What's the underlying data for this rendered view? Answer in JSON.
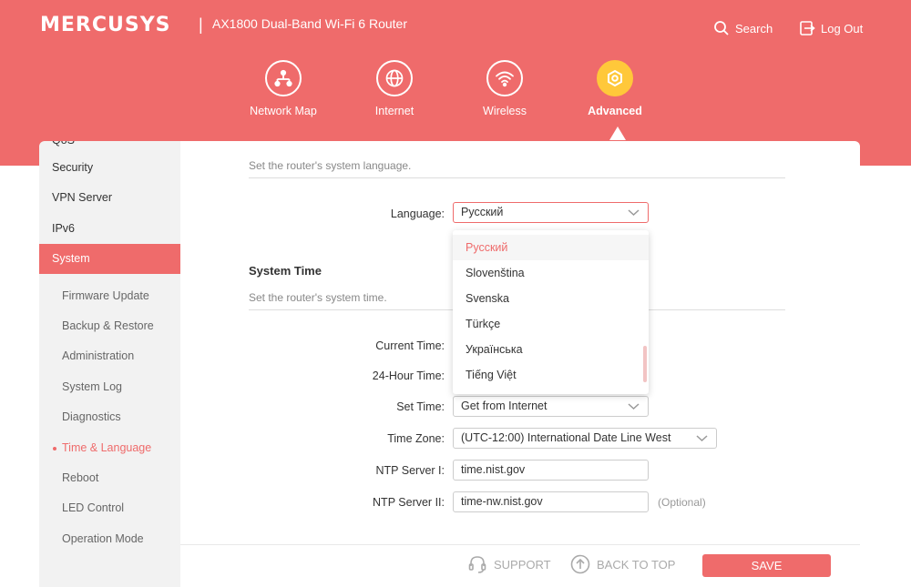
{
  "header": {
    "brand": "MERCUSYS",
    "separator": "|",
    "model": "AX1800 Dual-Band Wi-Fi 6 Router",
    "search_label": "Search",
    "logout_label": "Log Out"
  },
  "nav": {
    "items": [
      {
        "label": "Network Map",
        "icon": "network-map-icon"
      },
      {
        "label": "Internet",
        "icon": "globe-icon"
      },
      {
        "label": "Wireless",
        "icon": "wifi-icon"
      },
      {
        "label": "Advanced",
        "icon": "gear-icon",
        "active": true
      }
    ]
  },
  "sidebar": {
    "partial_top": "QoS",
    "items": [
      {
        "label": "Security"
      },
      {
        "label": "VPN Server"
      },
      {
        "label": "IPv6"
      },
      {
        "label": "System",
        "active": true
      }
    ],
    "subitems": [
      {
        "label": "Firmware Update"
      },
      {
        "label": "Backup & Restore"
      },
      {
        "label": "Administration"
      },
      {
        "label": "System Log"
      },
      {
        "label": "Diagnostics"
      },
      {
        "label": "Time & Language",
        "current": true
      },
      {
        "label": "Reboot"
      },
      {
        "label": "LED Control"
      },
      {
        "label": "Operation Mode"
      }
    ]
  },
  "language_section": {
    "description": "Set the router's system language.",
    "label": "Language:",
    "value": "Русский",
    "options": [
      {
        "label": "Русский",
        "selected": true
      },
      {
        "label": "Slovenština"
      },
      {
        "label": "Svenska"
      },
      {
        "label": "Türkçe"
      },
      {
        "label": "Українська"
      },
      {
        "label": "Tiếng Việt"
      }
    ]
  },
  "time_section": {
    "title": "System Time",
    "description": "Set the router's system time.",
    "current_time_label": "Current Time:",
    "hour24_label": "24-Hour Time:",
    "set_time_label": "Set Time:",
    "set_time_value": "Get from Internet",
    "timezone_label": "Time Zone:",
    "timezone_value": "(UTC-12:00) International Date Line West",
    "ntp1_label": "NTP Server I:",
    "ntp1_value": "time.nist.gov",
    "ntp2_label": "NTP Server II:",
    "ntp2_value": "time-nw.nist.gov",
    "optional_label": "(Optional)"
  },
  "footer": {
    "support_label": "SUPPORT",
    "back_to_top_label": "BACK TO TOP",
    "save_label": "SAVE"
  },
  "colors": {
    "brand": "#ef6b6b",
    "active_nav": "#ffc83a",
    "sidebar_bg": "#f2f2f2"
  }
}
